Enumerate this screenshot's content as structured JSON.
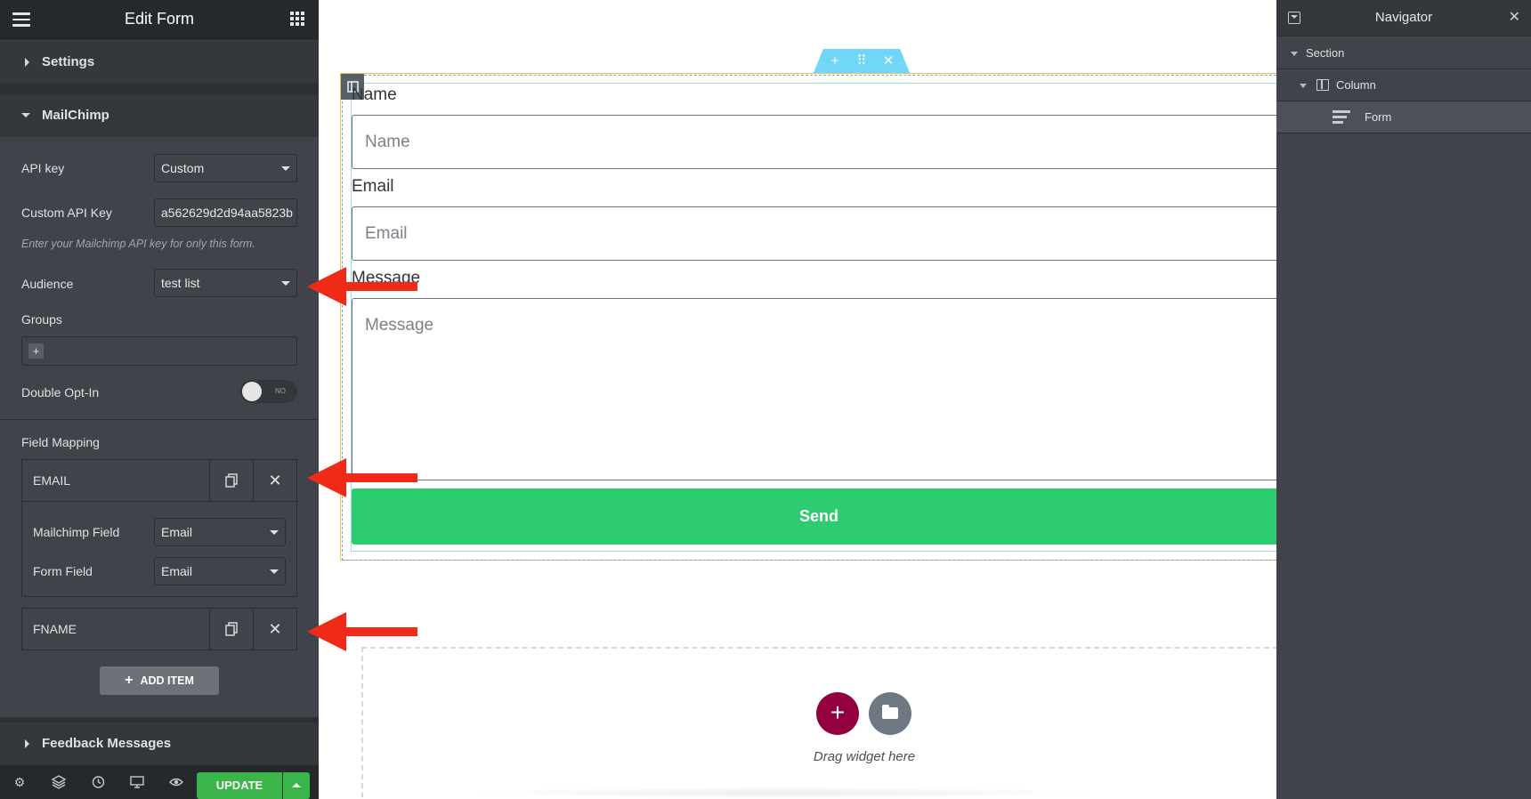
{
  "left_panel": {
    "title": "Edit Form",
    "sections": {
      "settings": "Settings",
      "mailchimp": "MailChimp",
      "feedback": "Feedback Messages"
    },
    "api_key": {
      "label": "API key",
      "value": "Custom"
    },
    "custom_api_key": {
      "label": "Custom API Key",
      "value": "a562629d2d94aa5823b",
      "description": "Enter your Mailchimp API key for only this form."
    },
    "audience": {
      "label": "Audience",
      "value": "test list"
    },
    "groups": {
      "label": "Groups",
      "add": "+"
    },
    "double_opt_in": {
      "label": "Double Opt-In",
      "state": "NO"
    },
    "field_mapping": {
      "label": "Field Mapping",
      "items": [
        {
          "title": "EMAIL",
          "mailchimp_field_label": "Mailchimp Field",
          "mailchimp_field_value": "Email",
          "form_field_label": "Form Field",
          "form_field_value": "Email"
        },
        {
          "title": "FNAME"
        }
      ],
      "add_item": "ADD ITEM"
    },
    "footer": {
      "update": "UPDATE"
    }
  },
  "canvas": {
    "fields": [
      {
        "label": "Name",
        "placeholder": "Name"
      },
      {
        "label": "Email",
        "placeholder": "Email"
      },
      {
        "label": "Message",
        "placeholder": "Message"
      }
    ],
    "send_button": "Send",
    "drop_zone": {
      "text": "Drag widget here"
    }
  },
  "navigator": {
    "title": "Navigator",
    "items": [
      "Section",
      "Column",
      "Form"
    ]
  },
  "colors": {
    "panel_bg": "#404349",
    "header_bg": "#26292c",
    "accent_green": "#39b54a",
    "send_green": "#2ecc71",
    "add_maroon": "#93003f",
    "arrow_red": "#ef2b17",
    "handle_blue": "#71d7f7"
  }
}
